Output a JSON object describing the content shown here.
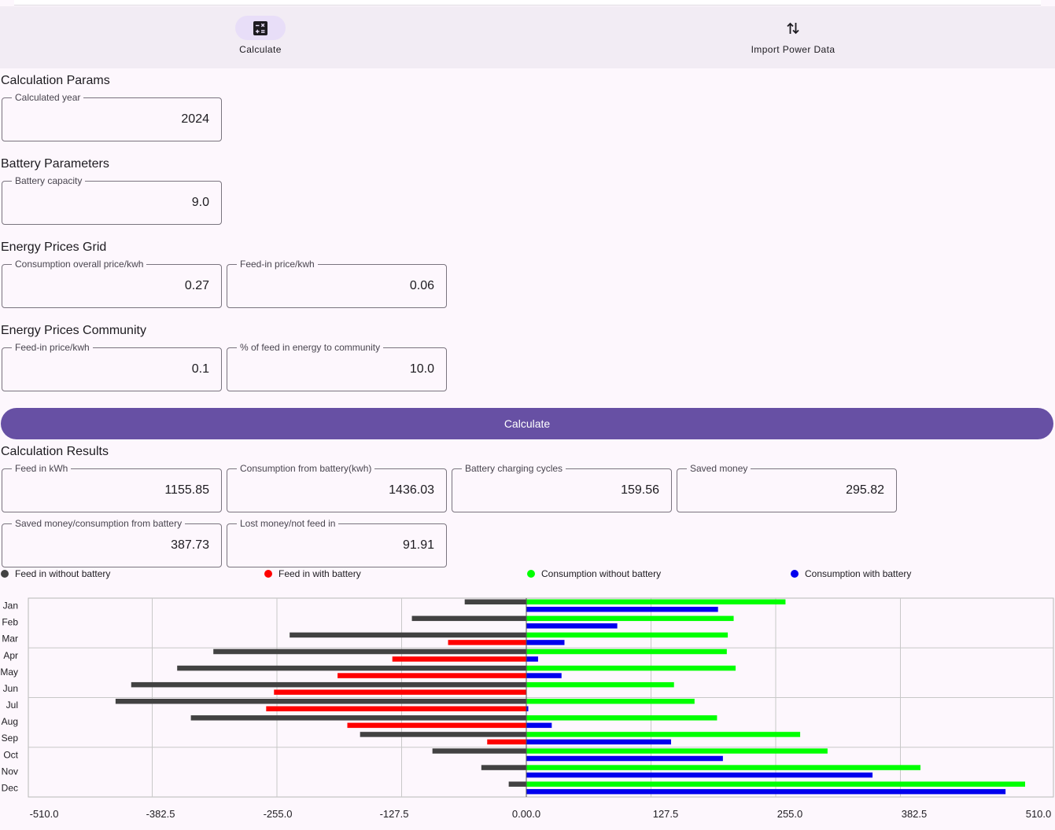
{
  "nav": {
    "items": [
      {
        "label": "Calculate",
        "icon": "calculator-icon"
      },
      {
        "label": "Import Power Data",
        "icon": "swap-vertical-icon"
      }
    ]
  },
  "params": {
    "title": "Calculation Params",
    "year_label": "Calculated year",
    "year_value": "2024"
  },
  "battery": {
    "title": "Battery Parameters",
    "capacity_label": "Battery capacity",
    "capacity_value": "9.0"
  },
  "grid": {
    "title": "Energy Prices Grid",
    "consumption_label": "Consumption overall price/kwh",
    "consumption_value": "0.27",
    "feedin_label": "Feed-in price/kwh",
    "feedin_value": "0.06"
  },
  "community": {
    "title": "Energy Prices Community",
    "feedin_label": "Feed-in price/kwh",
    "feedin_value": "0.1",
    "percent_label": "% of feed in energy to community",
    "percent_value": "10.0"
  },
  "calculate_button": "Calculate",
  "results": {
    "title": "Calculation Results",
    "feed_label": "Feed in kWh",
    "feed_value": "1155.85",
    "cons_battery_label": "Consumption from battery(kwh)",
    "cons_battery_value": "1436.03",
    "cycles_label": "Battery charging cycles",
    "cycles_value": "159.56",
    "saved_label": "Saved money",
    "saved_value": "295.82",
    "saved_cons_label": "Saved money/consumption from battery",
    "saved_cons_value": "387.73",
    "lost_label": "Lost money/not feed in",
    "lost_value": "91.91"
  },
  "colors": {
    "accent": "#6750a4",
    "feed_without": "#424242",
    "feed_with": "#ff0000",
    "cons_without": "#00ff00",
    "cons_with": "#0000ee"
  },
  "chart_data": {
    "type": "bar",
    "orientation": "horizontal",
    "categories": [
      "Jan",
      "Feb",
      "Mar",
      "Apr",
      "May",
      "Jun",
      "Jul",
      "Aug",
      "Sep",
      "Oct",
      "Nov",
      "Dec"
    ],
    "x_ticks": [
      "-510.0",
      "-382.5",
      "-255.0",
      "-127.5",
      "0.00.0",
      "127.5",
      "255.0",
      "382.5",
      "510.0"
    ],
    "xlim": [
      -510,
      510
    ],
    "grid": true,
    "legend_position": "top",
    "series": [
      {
        "name": "Feed in without battery",
        "color": "#424242",
        "values": [
          -63,
          -117,
          -242,
          -320,
          -357,
          -404,
          -420,
          -343,
          -170,
          -96,
          -46,
          -18
        ]
      },
      {
        "name": "Feed in with battery",
        "color": "#ff0000",
        "values": [
          0,
          0,
          -80,
          -137,
          -193,
          -258,
          -266,
          -183,
          -40,
          0,
          0,
          0
        ]
      },
      {
        "name": "Consumption without battery",
        "color": "#00ff00",
        "values": [
          265,
          212,
          206,
          205,
          214,
          151,
          172,
          195,
          280,
          308,
          403,
          510
        ]
      },
      {
        "name": "Consumption with battery",
        "color": "#0000ee",
        "values": [
          196,
          93,
          39,
          12,
          36,
          0,
          2,
          26,
          148,
          201,
          354,
          490
        ]
      }
    ]
  }
}
